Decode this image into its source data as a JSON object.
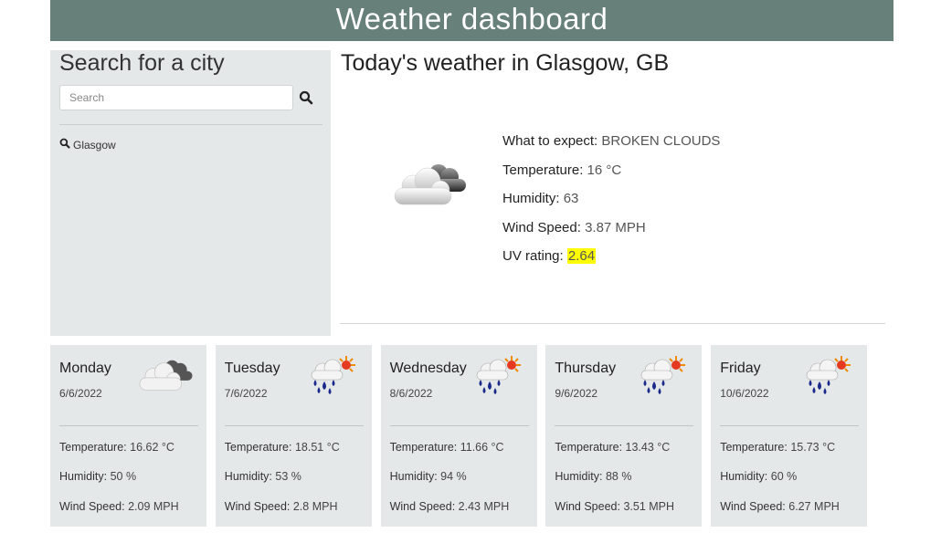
{
  "header": {
    "title": "Weather dashboard"
  },
  "sidebar": {
    "heading": "Search for a city",
    "search_placeholder": "Search",
    "search_icon": "search-icon",
    "history": [
      {
        "icon": "search-icon",
        "label": "Glasgow"
      }
    ]
  },
  "today": {
    "title": "Today's weather in Glasgow, GB",
    "icon": "broken-clouds-icon",
    "expect_label": "What to expect:",
    "expect_value": "BROKEN CLOUDS",
    "temp_label": "Temperature:",
    "temp_value": "16 °C",
    "humidity_label": "Humidity:",
    "humidity_value": "63",
    "wind_label": "Wind Speed:",
    "wind_value": "3.87 MPH",
    "uv_label": "UV rating:",
    "uv_value": "2.64",
    "uv_highlight": "#ffff00"
  },
  "forecast": [
    {
      "day": "Monday",
      "date": "6/6/2022",
      "icon": "broken-clouds-icon",
      "temp": "16.62 °C",
      "humidity": "50 %",
      "wind": "2.09 MPH"
    },
    {
      "day": "Tuesday",
      "date": "7/6/2022",
      "icon": "rain-sun-icon",
      "temp": "18.51 °C",
      "humidity": "53 %",
      "wind": "2.8 MPH"
    },
    {
      "day": "Wednesday",
      "date": "8/6/2022",
      "icon": "rain-sun-icon",
      "temp": "11.66 °C",
      "humidity": "94 %",
      "wind": "2.43 MPH"
    },
    {
      "day": "Thursday",
      "date": "9/6/2022",
      "icon": "rain-sun-icon",
      "temp": "13.43 °C",
      "humidity": "88 %",
      "wind": "3.51 MPH"
    },
    {
      "day": "Friday",
      "date": "10/6/2022",
      "icon": "rain-sun-icon",
      "temp": "15.73 °C",
      "humidity": "60 %",
      "wind": "6.27 MPH"
    }
  ],
  "labels": {
    "temperature": "Temperature:",
    "humidity": "Humidity:",
    "wind": "Wind Speed:"
  },
  "colors": {
    "header_bg": "#67807a",
    "panel_bg": "#e4e8e8"
  }
}
